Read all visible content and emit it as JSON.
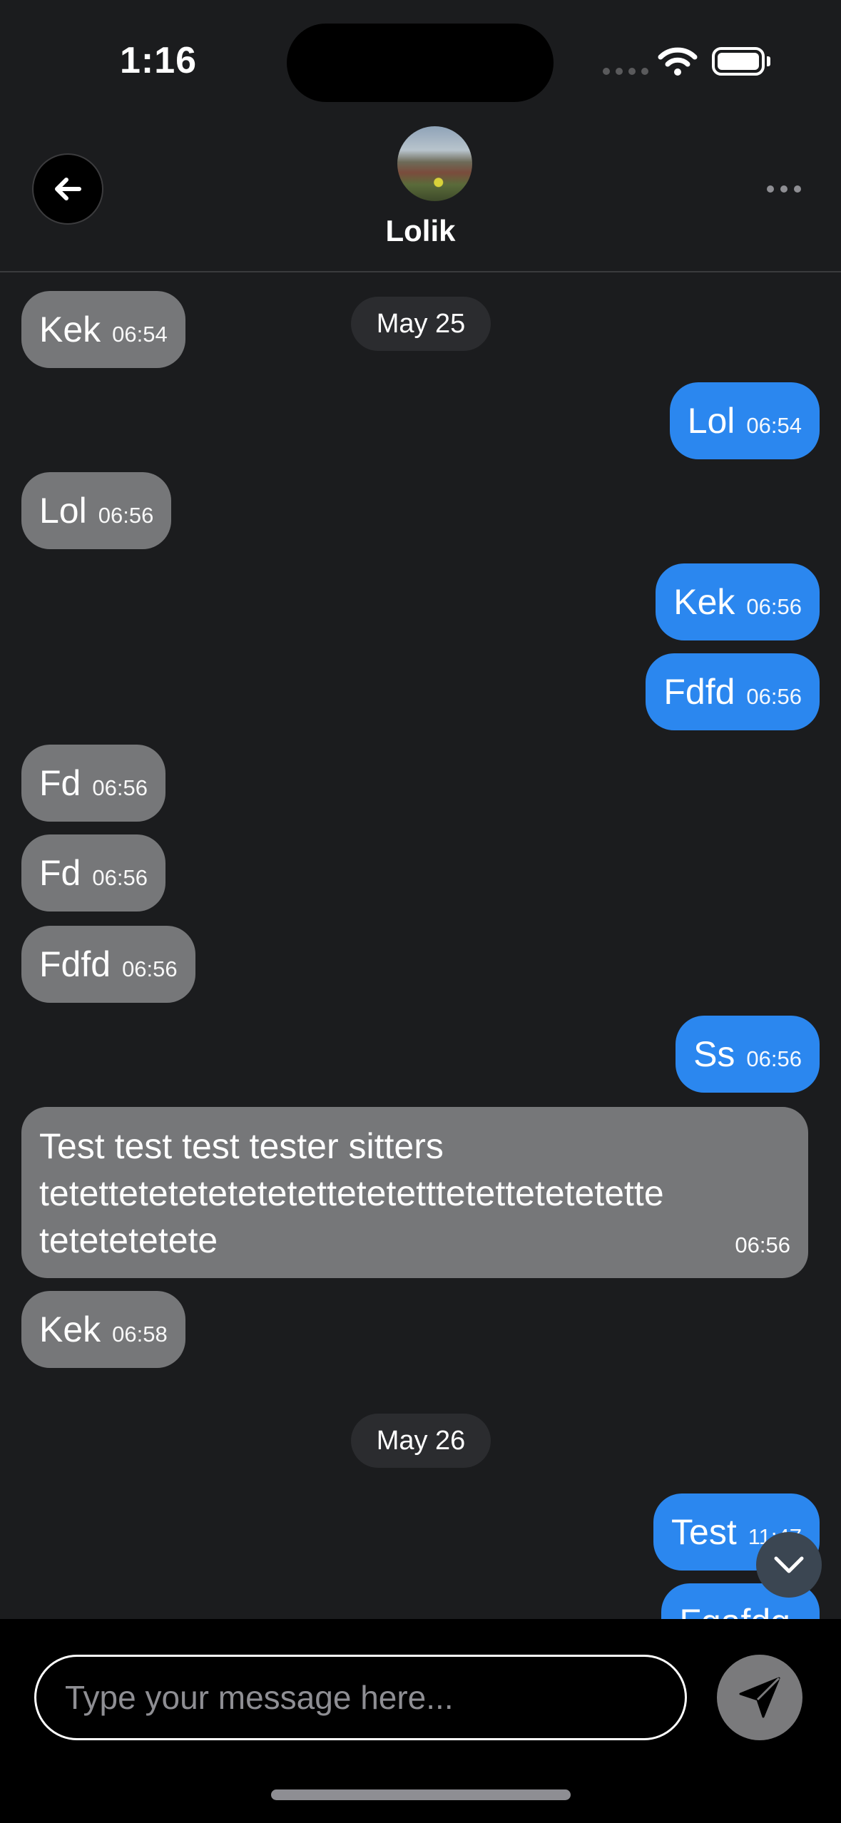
{
  "status_bar": {
    "time": "1:16",
    "battery_level": 1.0
  },
  "header": {
    "contact_name": "Lolik",
    "back_icon": "arrow-left-icon",
    "more_icon": "ellipsis-icon"
  },
  "dates": [
    "May 25",
    "May 26"
  ],
  "messages": [
    {
      "direction": "in",
      "text": "Kek",
      "time": "06:54"
    },
    {
      "direction": "out",
      "text": "Lol",
      "time": "06:54"
    },
    {
      "direction": "in",
      "text": "Lol",
      "time": "06:56"
    },
    {
      "direction": "out",
      "text": "Kek",
      "time": "06:56"
    },
    {
      "direction": "out",
      "text": "Fdfd",
      "time": "06:56"
    },
    {
      "direction": "in",
      "text": "Fd",
      "time": "06:56"
    },
    {
      "direction": "in",
      "text": "Fd",
      "time": "06:56"
    },
    {
      "direction": "in",
      "text": "Fdfd",
      "time": "06:56"
    },
    {
      "direction": "out",
      "text": "Ss",
      "time": "06:56"
    },
    {
      "direction": "in",
      "text": "Test test test tester sitters\ntetettetetetetetetettetetetttetettetetetette\ntetetetetete",
      "time": "06:56"
    },
    {
      "direction": "in",
      "text": "Kek",
      "time": "06:58"
    },
    {
      "direction": "out",
      "text": "Test",
      "time": "11:47"
    },
    {
      "direction": "out",
      "text": "Fgafdg",
      "time": ""
    }
  ],
  "composer": {
    "placeholder": "Type your message here...",
    "value": ""
  },
  "colors": {
    "background": "#1b1c1e",
    "incoming": "#767779",
    "outgoing": "#2b87ef",
    "date_pill": "#2b2c2f"
  }
}
